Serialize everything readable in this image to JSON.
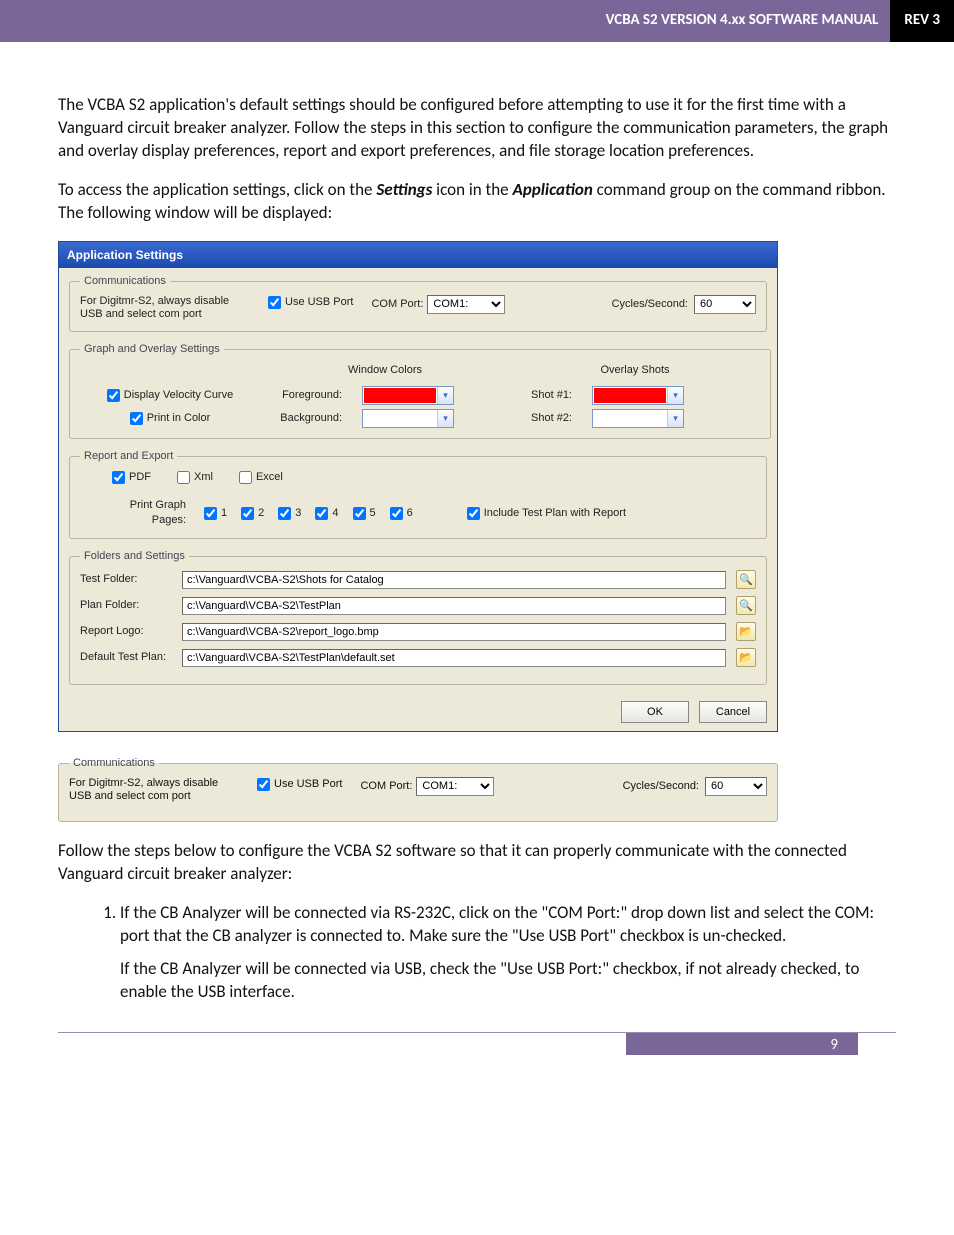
{
  "header": {
    "title": "VCBA S2 VERSION 4.xx SOFTWARE MANUAL",
    "rev": "REV 3"
  },
  "intro": {
    "p1": "The VCBA S2 application's default settings should be configured before attempting to use it for the first time with a Vanguard circuit breaker analyzer. Follow the steps in this section to configure the communication parameters, the graph and overlay display preferences, report and export preferences, and file storage location preferences.",
    "p2a": "To access the application settings, click on the ",
    "p2b_strong": "Settings",
    "p2c": " icon in the ",
    "p2d_strong": "Application",
    "p2e": " command group on the command ribbon. The following window will be displayed:"
  },
  "dialog": {
    "title": "Application Settings",
    "comm": {
      "legend": "Communications",
      "note": "For Digitmr-S2, always disable USB and select com port",
      "use_usb_label": "Use USB Port",
      "com_port_label": "COM Port:",
      "com_port_value": "COM1:",
      "cycles_label": "Cycles/Second:",
      "cycles_value": "60"
    },
    "graph": {
      "legend": "Graph and Overlay Settings",
      "window_colors": "Window Colors",
      "overlay_shots": "Overlay Shots",
      "display_velocity": "Display Velocity Curve",
      "print_color": "Print in Color",
      "foreground": "Foreground:",
      "background": "Background:",
      "shot1": "Shot #1:",
      "shot2": "Shot #2:",
      "colors": {
        "fg": "#ff0000",
        "bg": "#ffffff",
        "s1": "#ff0000",
        "s2": "#ffffff"
      }
    },
    "report": {
      "legend": "Report and Export",
      "pdf": "PDF",
      "xml": "Xml",
      "excel": "Excel",
      "print_pages_label": "Print Graph Pages:",
      "pages": [
        "1",
        "2",
        "3",
        "4",
        "5",
        "6"
      ],
      "include_test_plan": "Include Test Plan with Report"
    },
    "folders": {
      "legend": "Folders and Settings",
      "rows": [
        {
          "label": "Test Folder:",
          "value": "c:\\Vanguard\\VCBA-S2\\Shots for Catalog",
          "icon": "search"
        },
        {
          "label": "Plan Folder:",
          "value": "c:\\Vanguard\\VCBA-S2\\TestPlan",
          "icon": "search"
        },
        {
          "label": "Report Logo:",
          "value": "c:\\Vanguard\\VCBA-S2\\report_logo.bmp",
          "icon": "open"
        },
        {
          "label": "Default Test Plan:",
          "value": "c:\\Vanguard\\VCBA-S2\\TestPlan\\default.set",
          "icon": "open"
        }
      ]
    },
    "buttons": {
      "ok": "OK",
      "cancel": "Cancel"
    }
  },
  "follow_text": "Follow the steps below to configure the VCBA S2 software so that it can properly communicate with the connected Vanguard circuit breaker analyzer:",
  "step1": {
    "p1": "If the CB Analyzer will be connected via RS-232C, click on the \"COM Port:\" drop down list and select the COM: port that the CB analyzer is connected to. Make sure the \"Use USB Port\" checkbox is un-checked.",
    "p2": "If the CB Analyzer will be connected via USB, check the \"Use USB Port:\" checkbox, if not already checked, to enable the USB interface."
  },
  "page_number": "9"
}
